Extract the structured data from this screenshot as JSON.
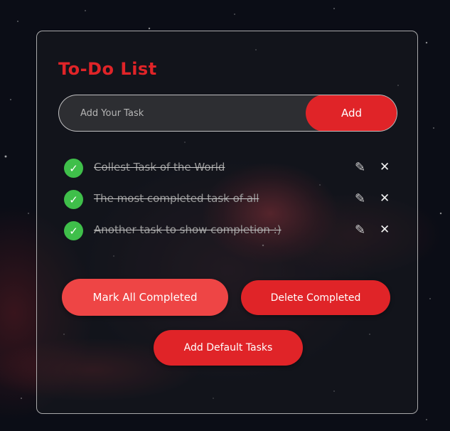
{
  "colors": {
    "accent": "#e02428",
    "accent_light": "#ee4545",
    "check_green": "#3fbf4a"
  },
  "app": {
    "title": "To-Do List"
  },
  "input": {
    "placeholder": "Add Your Task",
    "value": "",
    "add_label": "Add"
  },
  "tasks": [
    {
      "text": "Collest Task of the World",
      "completed": true,
      "check_icon": "✓",
      "edit_icon": "✎",
      "delete_icon": "✕"
    },
    {
      "text": "The most completed task of all",
      "completed": true,
      "check_icon": "✓",
      "edit_icon": "✎",
      "delete_icon": "✕"
    },
    {
      "text": "Another task to show completion :)",
      "completed": true,
      "check_icon": "✓",
      "edit_icon": "✎",
      "delete_icon": "✕"
    }
  ],
  "actions": {
    "mark_all_label": "Mark All Completed",
    "delete_completed_label": "Delete Completed",
    "add_default_label": "Add Default Tasks"
  }
}
